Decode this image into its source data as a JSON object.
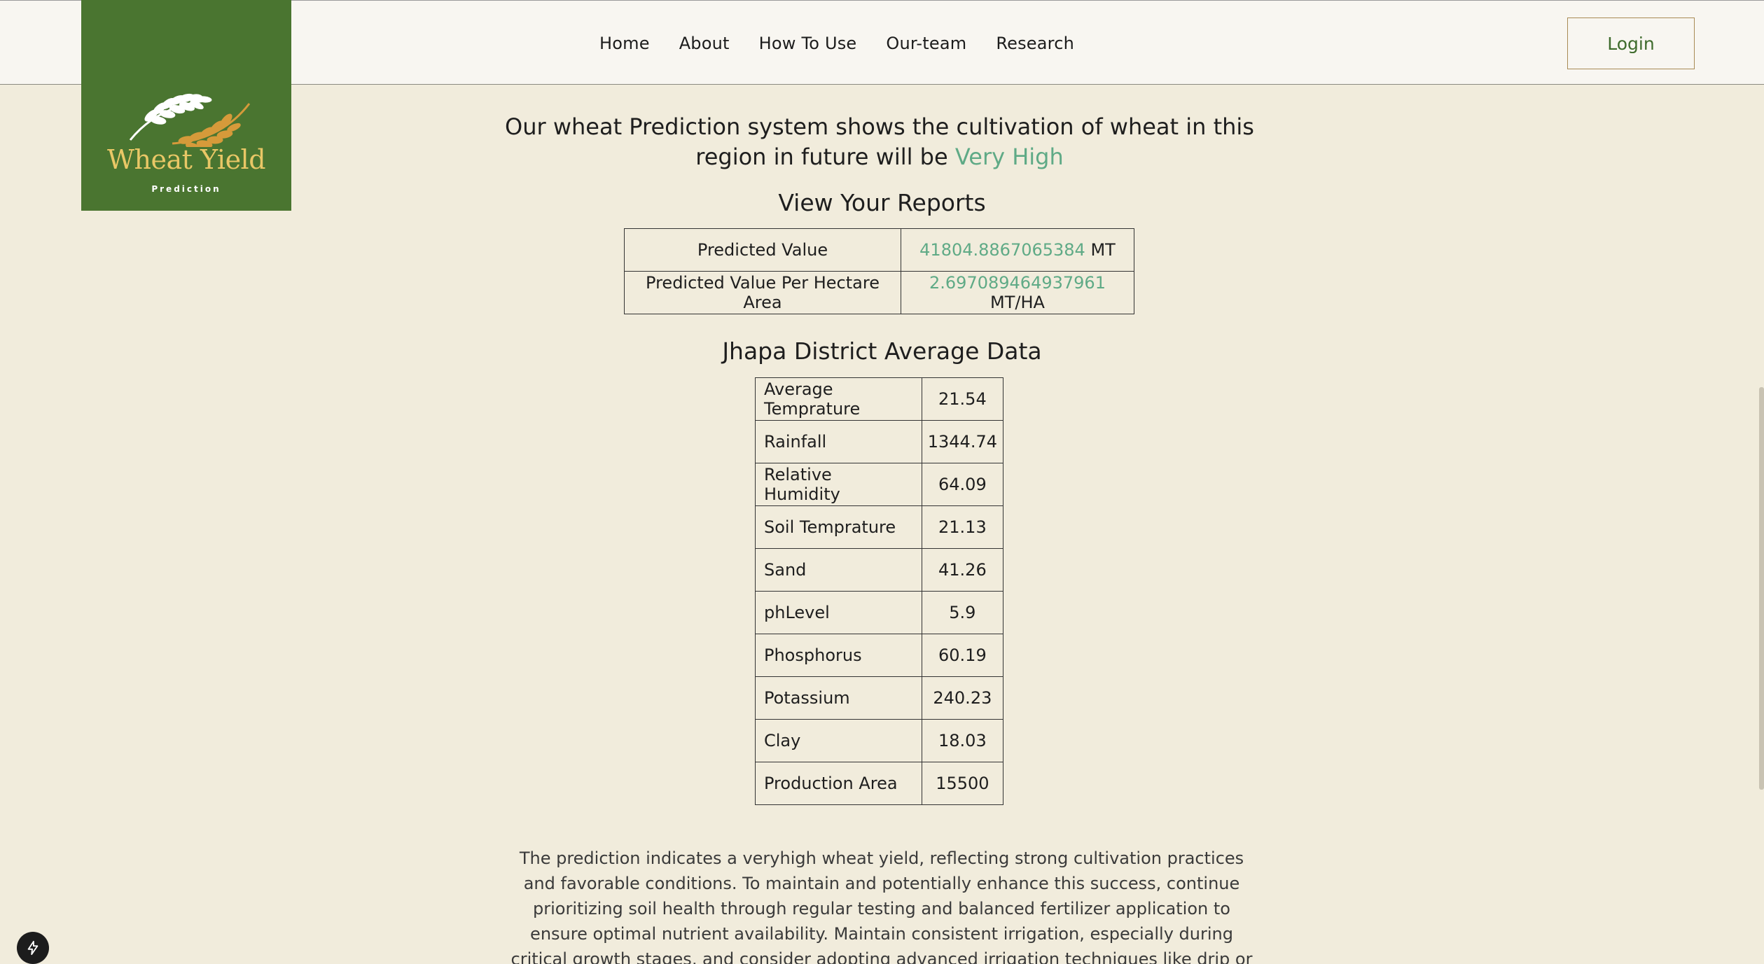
{
  "nav": {
    "links": [
      "Home",
      "About",
      "How To Use",
      "Our-team",
      "Research"
    ],
    "login_label": "Login"
  },
  "logo": {
    "title": "Wheat Yield",
    "subtitle": "Prediction"
  },
  "headline": {
    "line1": "Our wheat Prediction system shows the cultivation of wheat in this",
    "line2_prefix": "region in future will be ",
    "level": "Very High"
  },
  "reports": {
    "title": "View Your Reports",
    "rows": [
      {
        "label": "Predicted Value",
        "value": "41804.8867065384",
        "unit": " MT"
      },
      {
        "label": "Predicted Value Per Hectare Area",
        "value": "2.697089464937961",
        "unit": " MT/HA"
      }
    ]
  },
  "district": {
    "title": "Jhapa District Average Data",
    "rows": [
      {
        "label": "Average Temprature",
        "value": "21.54"
      },
      {
        "label": "Rainfall",
        "value": "1344.74"
      },
      {
        "label": "Relative Humidity",
        "value": "64.09"
      },
      {
        "label": "Soil Temprature",
        "value": "21.13"
      },
      {
        "label": "Sand",
        "value": "41.26"
      },
      {
        "label": "phLevel",
        "value": "5.9"
      },
      {
        "label": "Phosphorus",
        "value": "60.19"
      },
      {
        "label": "Potassium",
        "value": "240.23"
      },
      {
        "label": "Clay",
        "value": "18.03"
      },
      {
        "label": "Production Area",
        "value": "15500"
      }
    ]
  },
  "paragraph": "The prediction indicates a veryhigh wheat yield, reflecting strong cultivation practices and favorable conditions. To maintain and potentially enhance this success, continue prioritizing soil health through regular testing and balanced fertilizer application to ensure optimal nutrient availability. Maintain consistent irrigation, especially during critical growth stages, and consider adopting advanced irrigation techniques like drip or sprinkler systems for efficiency. Use high-",
  "colors": {
    "background": "#f1ecdc",
    "navbar": "#f8f6f1",
    "logo_bg": "#4a7530",
    "logo_gold": "#e9c766",
    "accent": "#5faa86",
    "login_text": "#3e6b2c"
  },
  "icons": {
    "logo": "wheat-icon",
    "floating_button": "bolt-icon"
  }
}
